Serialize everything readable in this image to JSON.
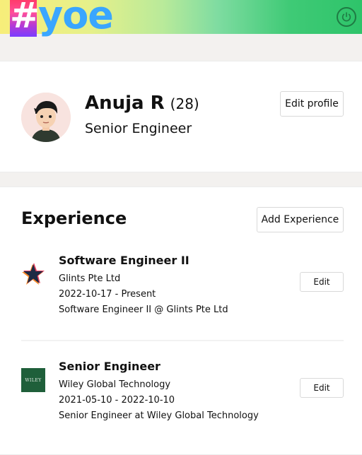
{
  "header": {
    "logo_hash": "#",
    "logo_text": "yoe",
    "power_icon": "power-icon"
  },
  "profile": {
    "name": "Anuja R",
    "age": "(28)",
    "title": "Senior Engineer",
    "edit_label": "Edit profile",
    "avatar_icon": "avatar-cartoon"
  },
  "experience": {
    "section_title": "Experience",
    "add_label": "Add Experience",
    "items": [
      {
        "role": "Software Engineer II",
        "company": "Glints Pte Ltd",
        "dates": "2022-10-17 - Present",
        "description": "Software Engineer II @ Glints Pte Ltd",
        "edit_label": "Edit",
        "logo_icon": "glints-star-logo"
      },
      {
        "role": "Senior Engineer",
        "company": "Wiley Global Technology",
        "dates": "2021-05-10 - 2022-10-10",
        "description": "Senior Engineer at Wiley Global Technology",
        "edit_label": "Edit",
        "logo_text": "WILEY",
        "logo_icon": "wiley-logo"
      }
    ]
  },
  "colors": {
    "header_start": "#f7ee7a",
    "header_end": "#2ec46a",
    "logo_blue": "#3aa6ff",
    "wiley_green": "#1f5f3a"
  }
}
